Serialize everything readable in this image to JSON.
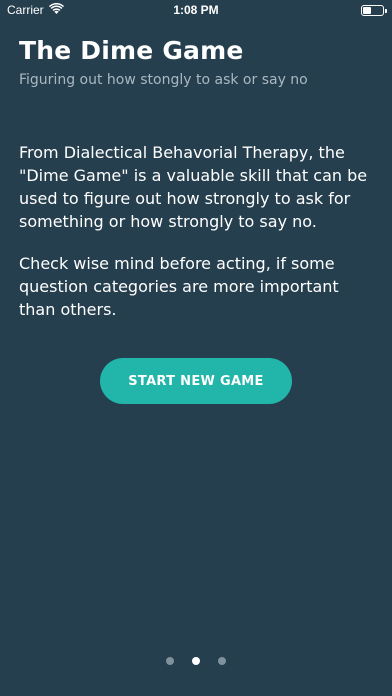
{
  "status_bar": {
    "carrier": "Carrier",
    "time": "1:08 PM",
    "wifi_icon": "wifi-icon",
    "battery_icon": "battery-icon"
  },
  "header": {
    "title": "The Dime Game",
    "subtitle": "Figuring out how stongly to ask or say no"
  },
  "content": {
    "paragraph_1": "From Dialectical Behavorial Therapy, the \"Dime Game\" is a valuable skill that can be used to figure out how strongly to ask for something or how strongly to say no.",
    "paragraph_2": "Check wise mind before acting, if some question categories are more important than others."
  },
  "actions": {
    "start_label": "START NEW GAME"
  },
  "pager": {
    "page_count": 3,
    "current_page": 2
  },
  "colors": {
    "background": "#263f4e",
    "accent": "#22b5aa",
    "subtitle": "#a9b8c1",
    "dot_inactive": "#7f919c"
  }
}
